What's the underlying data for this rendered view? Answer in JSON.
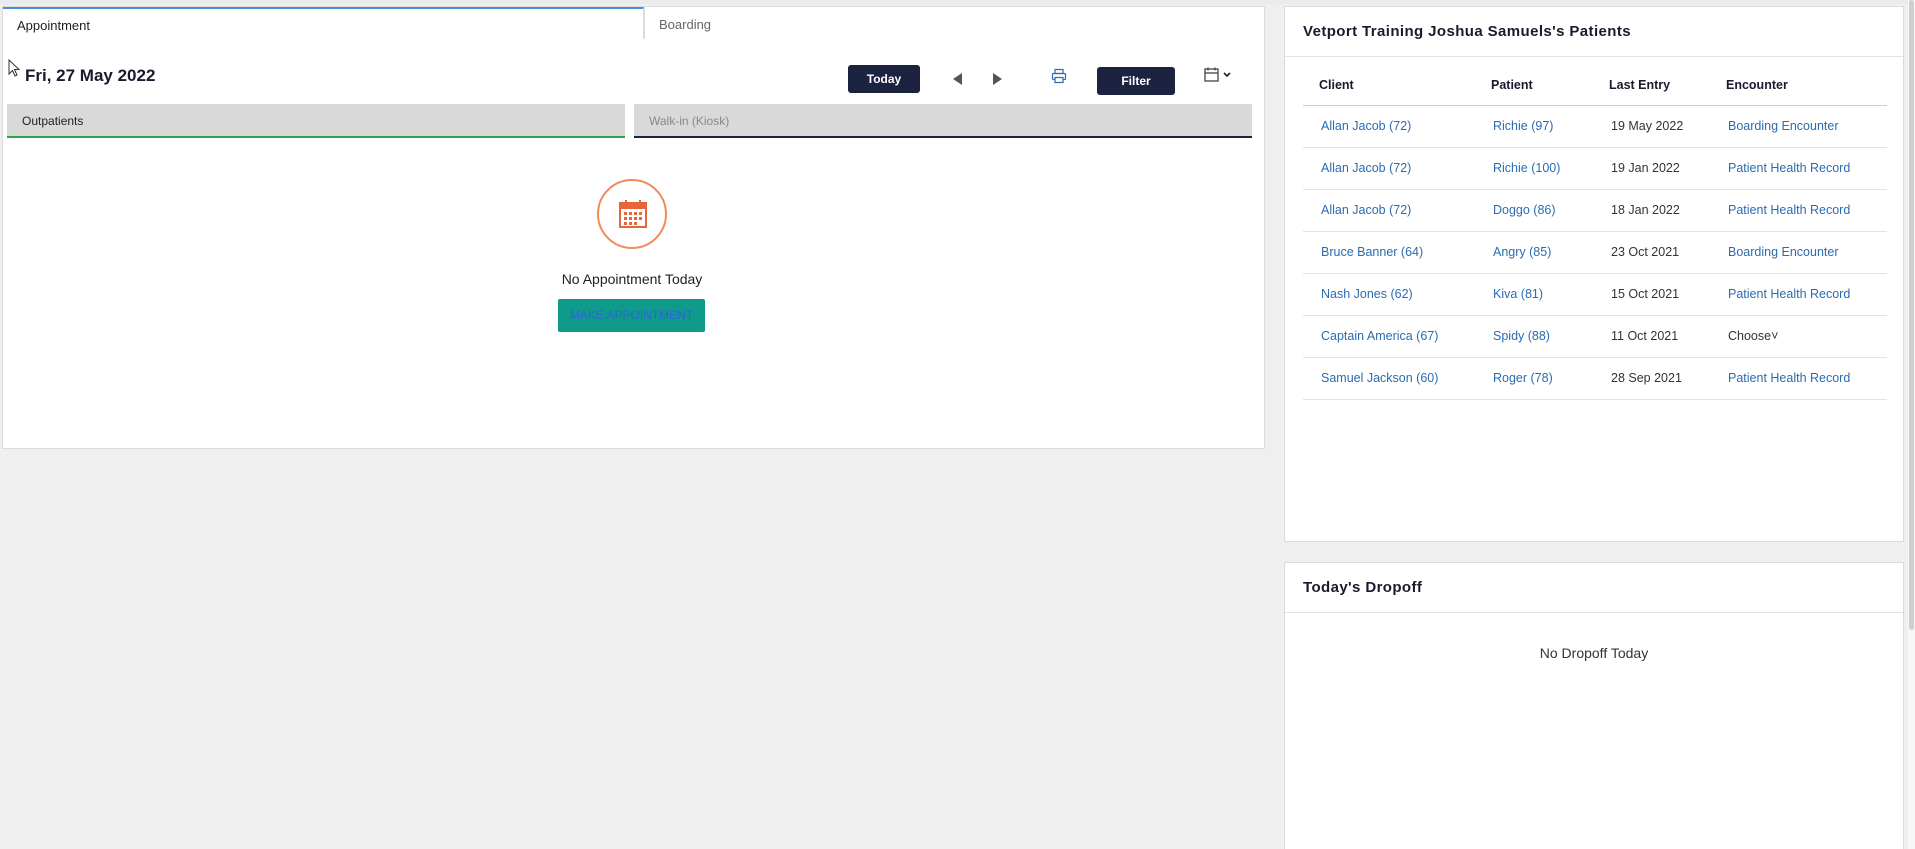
{
  "tabs": {
    "appointment": "Appointment",
    "boarding": "Boarding"
  },
  "toolbar": {
    "date": "Fri, 27 May 2022",
    "today_label": "Today",
    "filter_label": "Filter"
  },
  "subtabs": {
    "outpatients": "Outpatients",
    "walkin": "Walk-in (Kiosk)"
  },
  "empty_state": {
    "message": "No Appointment Today",
    "button_label": "MAKE APPOINTMENT"
  },
  "patients_panel": {
    "title": "Vetport Training Joshua Samuels's Patients",
    "columns": [
      "Client",
      "Patient",
      "Last Entry",
      "Encounter"
    ],
    "rows": [
      {
        "client": "Allan Jacob (72)",
        "patient": "Richie (97)",
        "last_entry": "19 May 2022",
        "encounter": "Boarding Encounter"
      },
      {
        "client": "Allan Jacob (72)",
        "patient": "Richie (100)",
        "last_entry": "19 Jan 2022",
        "encounter": "Patient Health Record"
      },
      {
        "client": "Allan Jacob (72)",
        "patient": "Doggo (86)",
        "last_entry": "18 Jan 2022",
        "encounter": "Patient Health Record"
      },
      {
        "client": "Bruce Banner (64)",
        "patient": "Angry (85)",
        "last_entry": "23 Oct 2021",
        "encounter": "Boarding Encounter"
      },
      {
        "client": "Nash Jones (62)",
        "patient": "Kiva (81)",
        "last_entry": "15 Oct 2021",
        "encounter": "Patient Health Record"
      },
      {
        "client": "Captain America (67)",
        "patient": "Spidy (88)",
        "last_entry": "11 Oct 2021",
        "encounter": "Choose"
      },
      {
        "client": "Samuel Jackson (60)",
        "patient": "Roger (78)",
        "last_entry": "28 Sep 2021",
        "encounter": "Patient Health Record"
      }
    ]
  },
  "dropoff_panel": {
    "title": "Today's Dropoff",
    "message": "No Dropoff Today"
  },
  "colors": {
    "primary_dark": "#1c2340",
    "accent_teal": "#0f9a8c",
    "link_blue": "#2b6cb0",
    "icon_orange": "#f08a5d",
    "tab_green": "#2ea44f"
  }
}
